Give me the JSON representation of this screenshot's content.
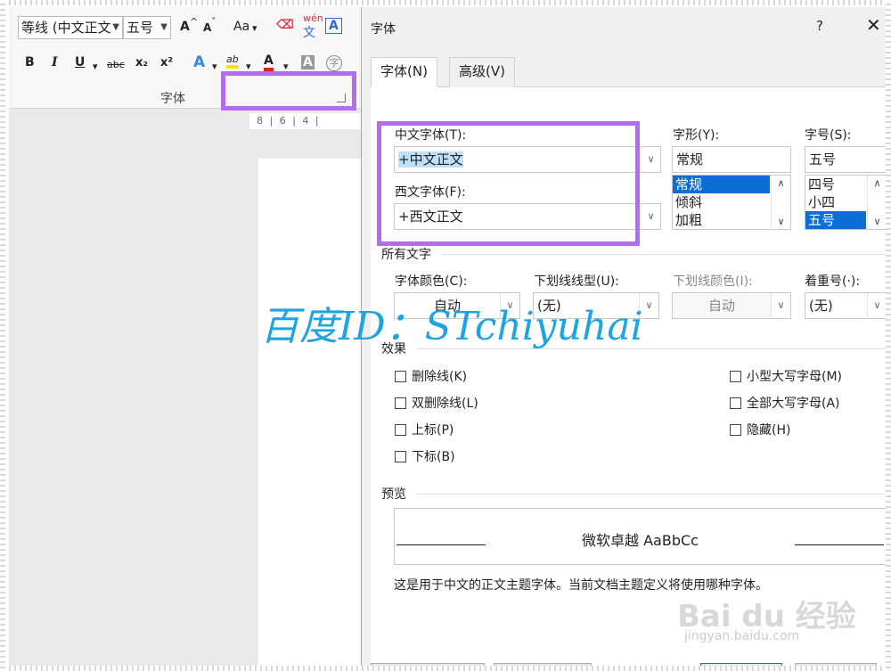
{
  "ribbon": {
    "font_name": "等线 (中文正文",
    "font_size": "五号",
    "grow_font": "A",
    "shrink_font": "A",
    "change_case": "Aa",
    "phonetic_guide_top": "wén",
    "phonetic_guide_bottom": "文",
    "char_border": "A",
    "bold": "B",
    "italic": "I",
    "underline": "U",
    "strikethrough": "abc",
    "subscript": "x₂",
    "superscript": "x²",
    "text_effects": "A",
    "highlight": "ab",
    "font_color": "A",
    "char_shading": "A",
    "enclose_chars": "字",
    "group_label": "字体",
    "ruler_text": "8 | 6 | 4 |"
  },
  "dialog": {
    "title": "字体",
    "help": "?",
    "close": "✕",
    "tabs": [
      {
        "label": "字体(N)",
        "active": true
      },
      {
        "label": "高级(V)",
        "active": false
      }
    ],
    "chinese_font_label": "中文字体(T):",
    "chinese_font_value": "+中文正文",
    "western_font_label": "西文字体(F):",
    "western_font_value": "+西文正文",
    "style_label": "字形(Y):",
    "style_value": "常规",
    "style_options": [
      "常规",
      "倾斜",
      "加粗"
    ],
    "size_label": "字号(S):",
    "size_value": "五号",
    "size_options": [
      "四号",
      "小四",
      "五号"
    ],
    "all_text_label": "所有文字",
    "font_color_label": "字体颜色(C):",
    "font_color_value": "自动",
    "underline_style_label": "下划线线型(U):",
    "underline_style_value": "(无)",
    "underline_color_label": "下划线颜色(I):",
    "underline_color_value": "自动",
    "emphasis_label": "着重号(·):",
    "emphasis_value": "(无)",
    "effects_label": "效果",
    "effects_left": [
      "删除线(K)",
      "双删除线(L)",
      "上标(P)",
      "下标(B)"
    ],
    "effects_right": [
      "小型大写字母(M)",
      "全部大写字母(A)",
      "隐藏(H)"
    ],
    "preview_label": "预览",
    "preview_text": "微软卓越  AaBbCc",
    "description": "这是用于中文的正文主题字体。当前文档主题定义将使用哪种字体。"
  },
  "watermark": "百度ID：STchiyuhai",
  "baidu_logo": "Bai du 经验",
  "baidu_url": "jingyan.baidu.com",
  "colors": {
    "highlight_box": "#b36cf0",
    "watermark": "#20a4e0",
    "selection": "#0b6fd4"
  }
}
